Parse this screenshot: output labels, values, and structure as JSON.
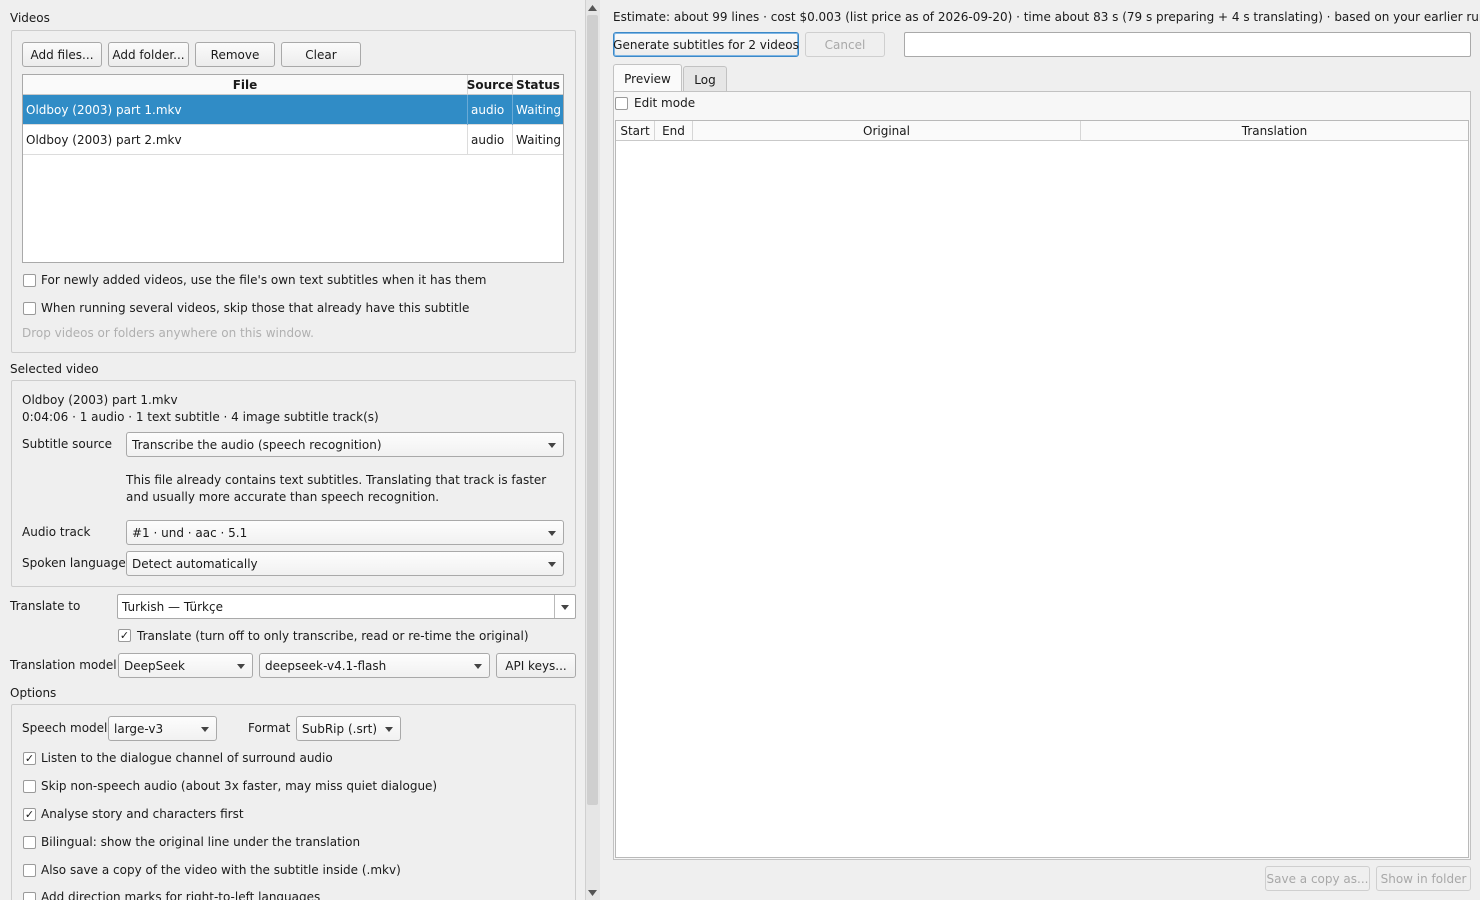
{
  "videos": {
    "title": "Videos",
    "buttons": {
      "add_files": "Add files...",
      "add_folder": "Add folder...",
      "remove": "Remove",
      "clear": "Clear"
    },
    "table": {
      "headers": {
        "file": "File",
        "source": "Source",
        "status": "Status"
      },
      "rows": [
        {
          "file": "Oldboy (2003) part 1.mkv",
          "source": "audio",
          "status": "Waiting",
          "selected": true
        },
        {
          "file": "Oldboy (2003) part 2.mkv",
          "source": "audio",
          "status": "Waiting",
          "selected": false
        }
      ]
    },
    "use_own_subs": {
      "label": "For newly added videos, use the file's own text subtitles when it has them",
      "checked": false
    },
    "skip_existing": {
      "label": "When running several videos, skip those that already have this subtitle",
      "checked": false
    },
    "drop_hint": "Drop videos or folders anywhere on this window."
  },
  "selected_video": {
    "title": "Selected video",
    "filename": "Oldboy (2003) part 1.mkv",
    "info": "0:04:06 · 1 audio · 1 text subtitle · 4 image subtitle track(s)",
    "subtitle_source": {
      "label": "Subtitle source",
      "value": "Transcribe the audio (speech recognition)"
    },
    "note": "This file already contains text subtitles. Translating that track is faster and usually more accurate than speech recognition.",
    "audio_track": {
      "label": "Audio track",
      "value": "#1 · und · aac · 5.1"
    },
    "spoken_language": {
      "label": "Spoken language",
      "value": "Detect automatically"
    }
  },
  "translate": {
    "label": "Translate to",
    "value": "Turkish — Türkçe",
    "toggle": {
      "label": "Translate (turn off to only transcribe, read or re-time the original)",
      "checked": true
    },
    "model_label": "Translation model",
    "provider": "DeepSeek",
    "model": "deepseek-v4.1-flash",
    "api_keys": "API keys..."
  },
  "options": {
    "title": "Options",
    "speech_model": {
      "label": "Speech model",
      "value": "large-v3"
    },
    "format": {
      "label": "Format",
      "value": "SubRip (.srt)"
    },
    "checks": [
      {
        "label": "Listen to the dialogue channel of surround audio",
        "checked": true
      },
      {
        "label": "Skip non-speech audio (about 3x faster, may miss quiet dialogue)",
        "checked": false
      },
      {
        "label": "Analyse story and characters first",
        "checked": true
      },
      {
        "label": "Bilingual: show the original line under the translation",
        "checked": false
      },
      {
        "label": "Also save a copy of the video with the subtitle inside (.mkv)",
        "checked": false
      },
      {
        "label": "Add direction marks for right-to-left languages",
        "checked": false
      }
    ]
  },
  "right": {
    "estimate": "Estimate: about 99 lines · cost $0.003 (list price as of 2026-09-20) · time about 83 s (79 s preparing + 4 s translating) · based on your earlier runs",
    "generate": "Generate subtitles for 2 videos",
    "cancel": "Cancel",
    "tabs": {
      "preview": "Preview",
      "log": "Log"
    },
    "edit_mode": {
      "label": "Edit mode",
      "checked": false
    },
    "columns": {
      "start": "Start",
      "end": "End",
      "original": "Original",
      "translation": "Translation"
    },
    "save_copy": "Save a copy as...",
    "show_folder": "Show in folder"
  }
}
